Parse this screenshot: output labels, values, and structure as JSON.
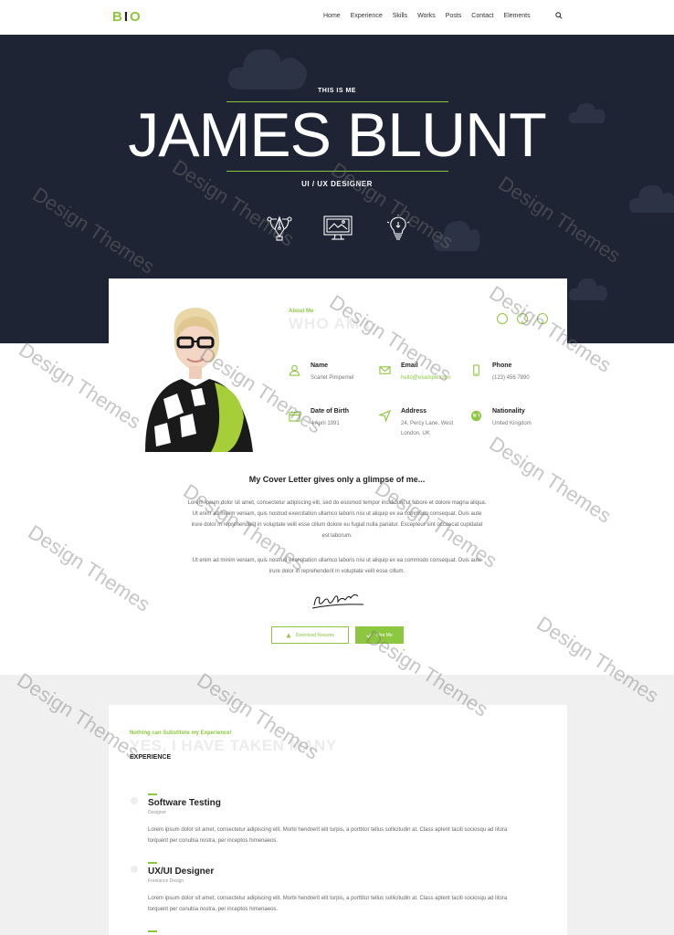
{
  "nav": {
    "logo_part1": "B",
    "logo_part2": "I",
    "logo_part3": "O",
    "items": [
      "Home",
      "Experience",
      "Skills",
      "Works",
      "Posts",
      "Contact",
      "Elements"
    ],
    "icons": {
      "search": "search-icon"
    }
  },
  "hero": {
    "eyebrow": "THIS IS ME",
    "name": "JAMES BLUNT",
    "role": "UI / UX DESIGNER",
    "icons": [
      "pen-tool-icon",
      "monitor-icon",
      "lightbulb-icon"
    ]
  },
  "about": {
    "eyebrow": "About Me",
    "title": "WHO AM I",
    "fields": [
      {
        "label": "Name",
        "value": "Scarlet Pimpernel",
        "icon": "user-icon"
      },
      {
        "label": "Email",
        "value": "hello@example.com",
        "icon": "envelope-icon"
      },
      {
        "label": "Phone",
        "value": "(123) 456 7890",
        "icon": "phone-icon"
      },
      {
        "label": "Date of Birth",
        "value": "4 April 1991",
        "icon": "calendar-icon"
      },
      {
        "label": "Address",
        "value": "24, Percy Lane, West London, UK",
        "icon": "location-arrow-icon"
      },
      {
        "label": "Nationality",
        "value": "United Kingdom",
        "icon": "globe-icon"
      }
    ]
  },
  "cover": {
    "title": "My Cover Letter gives only a glimpse of me...",
    "para1": "Lorem ipsum dolor sit amet, consectetur adipiscing elit, sed do eiusmod tempor incididunt ut labore et dolore magna aliqua. Ut enim ad minim veniam, quis nostrud exercitation ullamco laboris nisi ut aliquip ex ea commodo consequat. Duis aute irure dolor in reprehenderit in voluptate velit esse cillum dolore eu fugiat nulla pariatur. Excepteur sint occaecat cupidatat est laborum.",
    "para2": "Ut enim ad minim veniam, quis nostrud exercitation ullamco laboris nisi ut aliquip ex ea commodo consequat. Duis aute irure dolor in reprehenderit in voluptate velit esse cillum.",
    "btn_resume": "Download Resume",
    "btn_hire": "Hire Me"
  },
  "experience": {
    "eyebrow": "Nothing can Substitute my Experience!",
    "title": "YES, I HAVE TAKEN MANY",
    "label": "EXPERIENCE",
    "jobs": [
      {
        "title": "Software Testing",
        "subtitle": "Designer",
        "desc": "Lorem ipsum dolor sit amet, consectetur adipiscing elit. Morbi hendrerit elit turpis, a porttitor tellus sollicitudin at. Class aptent taciti sociosqu ad litora torquent per conubia nostra, per inceptos himenaeos."
      },
      {
        "title": "UX/UI Designer",
        "subtitle": "Freelance Design",
        "desc": "Lorem ipsum dolor sit amet, consectetur adipiscing elit. Morbi hendrerit elit turpis, a porttitor tellus sollicitudin at. Class aptent taciti sociosqu ad litora torquent per conubia nostra, per inceptos himenaeos."
      }
    ]
  },
  "watermark": "Design Themes",
  "colors": {
    "accent": "#8dc63f",
    "hero_bg": "#1e2433",
    "page_bg": "#f0f0f0"
  }
}
